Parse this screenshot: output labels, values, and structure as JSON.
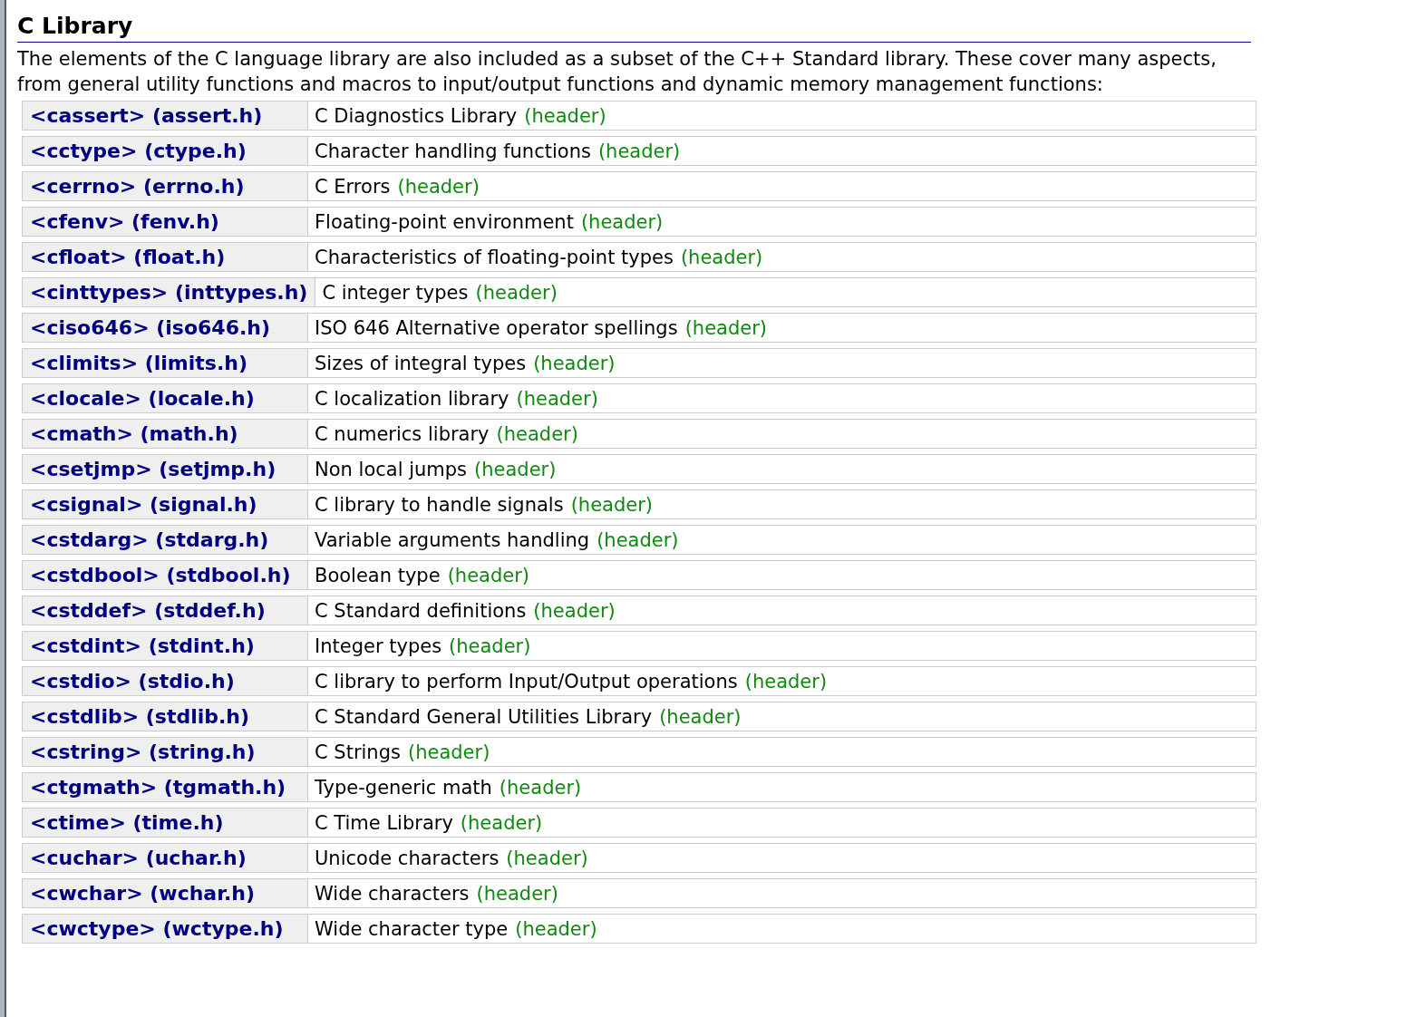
{
  "section": {
    "title": "C Library",
    "intro": "The elements of the C language library are also included as a subset of the C++ Standard library. These cover many aspects, from general utility functions and macros to input/output functions and dynamic memory management functions:"
  },
  "headers": [
    {
      "name": "<cassert> (assert.h)",
      "description": "C Diagnostics Library",
      "tag": "(header)"
    },
    {
      "name": "<cctype> (ctype.h)",
      "description": "Character handling functions",
      "tag": "(header)"
    },
    {
      "name": "<cerrno> (errno.h)",
      "description": "C Errors",
      "tag": "(header)"
    },
    {
      "name": "<cfenv> (fenv.h)",
      "description": "Floating-point environment",
      "tag": "(header)"
    },
    {
      "name": "<cfloat> (float.h)",
      "description": "Characteristics of floating-point types",
      "tag": "(header)"
    },
    {
      "name": "<cinttypes> (inttypes.h)",
      "description": "C integer types",
      "tag": "(header)"
    },
    {
      "name": "<ciso646> (iso646.h)",
      "description": "ISO 646 Alternative operator spellings",
      "tag": "(header)"
    },
    {
      "name": "<climits> (limits.h)",
      "description": "Sizes of integral types",
      "tag": "(header)"
    },
    {
      "name": "<clocale> (locale.h)",
      "description": "C localization library",
      "tag": "(header)"
    },
    {
      "name": "<cmath> (math.h)",
      "description": "C numerics library",
      "tag": "(header)"
    },
    {
      "name": "<csetjmp> (setjmp.h)",
      "description": "Non local jumps",
      "tag": "(header)"
    },
    {
      "name": "<csignal> (signal.h)",
      "description": "C library to handle signals",
      "tag": "(header)"
    },
    {
      "name": "<cstdarg> (stdarg.h)",
      "description": "Variable arguments handling",
      "tag": "(header)"
    },
    {
      "name": "<cstdbool> (stdbool.h)",
      "description": "Boolean type",
      "tag": "(header)"
    },
    {
      "name": "<cstddef> (stddef.h)",
      "description": "C Standard definitions",
      "tag": "(header)"
    },
    {
      "name": "<cstdint> (stdint.h)",
      "description": "Integer types",
      "tag": "(header)"
    },
    {
      "name": "<cstdio> (stdio.h)",
      "description": "C library to perform Input/Output operations",
      "tag": "(header)"
    },
    {
      "name": "<cstdlib> (stdlib.h)",
      "description": "C Standard General Utilities Library",
      "tag": "(header)"
    },
    {
      "name": "<cstring> (string.h)",
      "description": "C Strings",
      "tag": "(header)"
    },
    {
      "name": "<ctgmath> (tgmath.h)",
      "description": "Type-generic math",
      "tag": "(header)"
    },
    {
      "name": "<ctime> (time.h)",
      "description": "C Time Library",
      "tag": "(header)"
    },
    {
      "name": "<cuchar> (uchar.h)",
      "description": "Unicode characters",
      "tag": "(header)"
    },
    {
      "name": "<cwchar> (wchar.h)",
      "description": "Wide characters",
      "tag": "(header)"
    },
    {
      "name": "<cwctype> (wctype.h)",
      "description": "Wide character type",
      "tag": "(header)"
    }
  ]
}
